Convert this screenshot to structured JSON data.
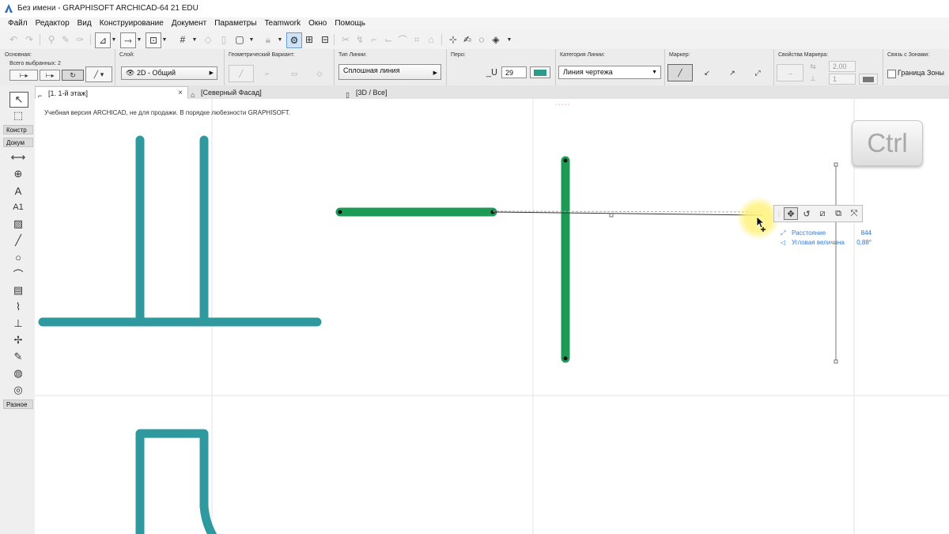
{
  "window": {
    "title": "Без имени - GRAPHISOFT ARCHICAD-64 21 EDU"
  },
  "menu": [
    "Файл",
    "Редактор",
    "Вид",
    "Конструирование",
    "Документ",
    "Параметры",
    "Teamwork",
    "Окно",
    "Помощь"
  ],
  "infobox": {
    "main_label": "Основная:",
    "selected_label": "Всего выбранных: 2",
    "layer_label": "Слой:",
    "layer_value": "2D - Общий",
    "geometry_label": "Геометрический Вариант:",
    "linetype_label": "Тип Линии:",
    "linetype_value": "Сплошная линия",
    "pen_label": "Перо:",
    "pen_value": "29",
    "category_label": "Категория Линии:",
    "category_value": "Линия чертежа",
    "marker_label": "Маркер:",
    "marker_props_label": "Свойства Маркера:",
    "marker_size": "2,00",
    "marker_pen": "1",
    "zone_label": "Связь с Зонами:",
    "zone_checkbox_label": "Граница Зоны"
  },
  "tabs": [
    {
      "label": "[1. 1-й этаж]",
      "active": true
    },
    {
      "label": "[Северный Фасад]",
      "active": false
    },
    {
      "label": "[3D / Все]",
      "active": false
    }
  ],
  "toolbox": {
    "groups": [
      "Констр",
      "Докум",
      "Разное"
    ],
    "text_tool": "A",
    "label_tool": "A1"
  },
  "canvas": {
    "watermark": "Учебная версия ARCHICAD, не для продажи. В порядке любезности GRAPHISOFT.",
    "ctrl_key": "Ctrl",
    "tracker": [
      {
        "label": "Расстояние",
        "value": "844"
      },
      {
        "label": "Угловая величина",
        "value": "0,88°"
      }
    ]
  },
  "colors": {
    "teal_line": "#2e9aa0",
    "green_line": "#1d9a55",
    "tracker_text": "#3a7bd5",
    "grid": "#e3e3e3"
  }
}
